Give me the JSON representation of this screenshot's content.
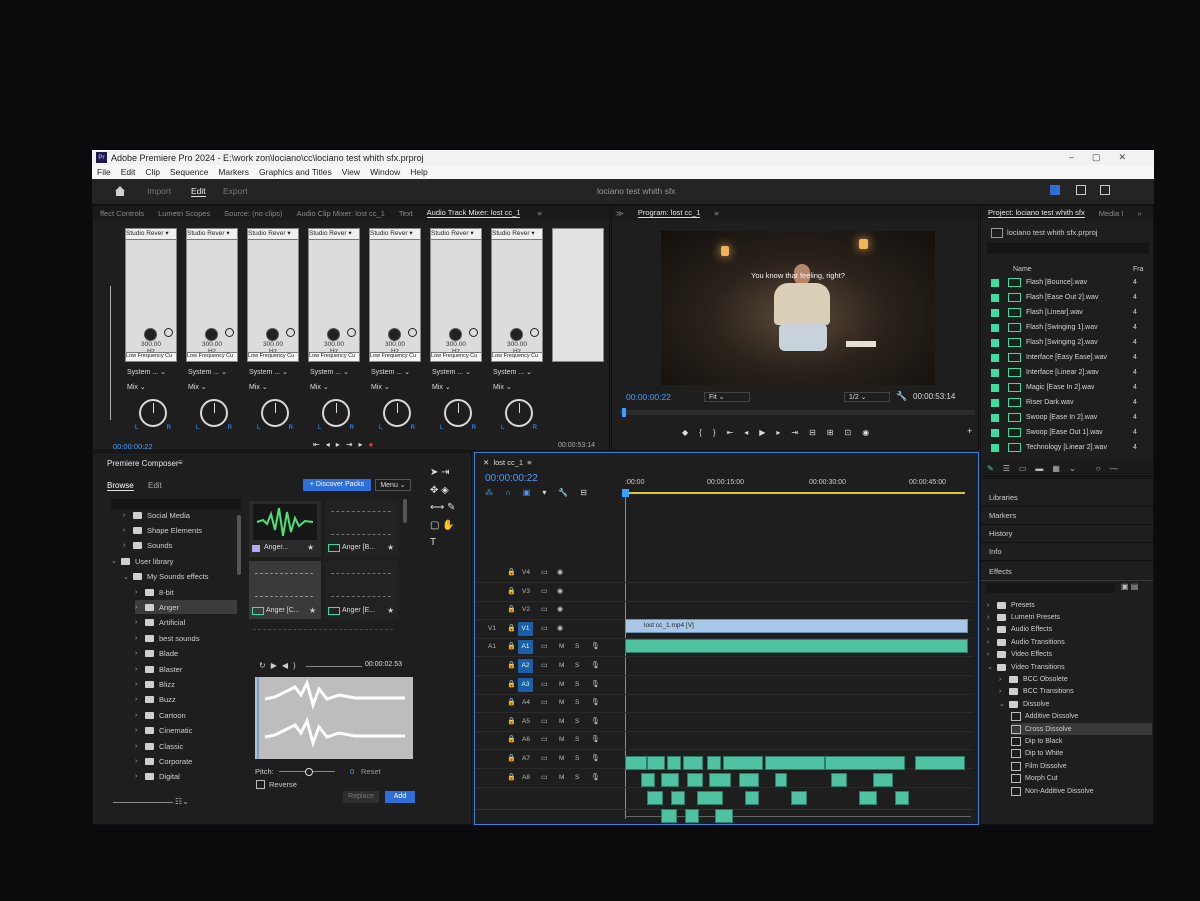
{
  "window": {
    "title": "Adobe Premiere Pro 2024 - E:\\work zon\\lociano\\cc\\lociano test whith sfx.prproj",
    "menu": [
      "File",
      "Edit",
      "Clip",
      "Sequence",
      "Markers",
      "Graphics and Titles",
      "View",
      "Window",
      "Help"
    ]
  },
  "header": {
    "workspaces": [
      "Import",
      "Edit",
      "Export"
    ],
    "active_workspace": "Edit",
    "project_name": "lociano test whith sfx"
  },
  "mixer": {
    "tabs": [
      "ffect Controls",
      "Lumetri Scopes",
      "Source: (no clips)",
      "Audio Clip Mixer: lost cc_1",
      "Text",
      "Audio Track Mixer: lost cc_1"
    ],
    "effect_label": "Studio Rever",
    "hz_value": "300.00",
    "hz_unit": "Hz",
    "low_freq_label": "Low Frequency Cu",
    "system_label": "System ...",
    "mix_label": "Mix",
    "timecode_left": "00:00:00:22",
    "timecode_right": "00:00:53:14"
  },
  "program": {
    "title": "Program: lost cc_1",
    "subtitle": "You know that feeling, right?",
    "timecode": "00:00:00:22",
    "fit": "Fit",
    "resolution": "1/2",
    "duration": "00:00:53:14"
  },
  "project": {
    "title": "Project: lociano test whith sfx",
    "tab2": "Media I",
    "file": "lociano test whith sfx.prproj",
    "col_name": "Name",
    "col_frame": "Fra",
    "items": [
      {
        "name": "Flash [Bounce].wav",
        "rate": "4"
      },
      {
        "name": "Flash [Ease Out 2].wav",
        "rate": "4"
      },
      {
        "name": "Flash [Linear].wav",
        "rate": "4"
      },
      {
        "name": "Flash [Swinging 1].wav",
        "rate": "4"
      },
      {
        "name": "Flash [Swinging 2].wav",
        "rate": "4"
      },
      {
        "name": "Interface [Easy Ease].wav",
        "rate": "4"
      },
      {
        "name": "Interface [Linear 2].wav",
        "rate": "4"
      },
      {
        "name": "Magic [Ease In 2].wav",
        "rate": "4"
      },
      {
        "name": "Riser Dark.wav",
        "rate": "4"
      },
      {
        "name": "Swoop [Ease In 2].wav",
        "rate": "4"
      },
      {
        "name": "Swoop [Ease Out 1].wav",
        "rate": "4"
      },
      {
        "name": "Technology [Linear 2].wav",
        "rate": "4"
      }
    ]
  },
  "side_panels": [
    "Libraries",
    "Markers",
    "History",
    "Info",
    "Effects"
  ],
  "effects": [
    {
      "label": "Presets",
      "indent": 0,
      "expanded": false
    },
    {
      "label": "Lumetri Presets",
      "indent": 0,
      "expanded": false
    },
    {
      "label": "Audio Effects",
      "indent": 0,
      "expanded": false
    },
    {
      "label": "Audio Transitions",
      "indent": 0,
      "expanded": false
    },
    {
      "label": "Video Effects",
      "indent": 0,
      "expanded": false
    },
    {
      "label": "Video Transitions",
      "indent": 0,
      "expanded": true
    },
    {
      "label": "BCC Obsolete",
      "indent": 1,
      "expanded": false
    },
    {
      "label": "BCC Transitions",
      "indent": 1,
      "expanded": false
    },
    {
      "label": "Dissolve",
      "indent": 1,
      "expanded": true
    },
    {
      "label": "Additive Dissolve",
      "indent": 2,
      "item": true
    },
    {
      "label": "Cross Dissolve",
      "indent": 2,
      "item": true,
      "selected": true
    },
    {
      "label": "Dip to Black",
      "indent": 2,
      "item": true
    },
    {
      "label": "Dip to White",
      "indent": 2,
      "item": true
    },
    {
      "label": "Film Dissolve",
      "indent": 2,
      "item": true
    },
    {
      "label": "Morph Cut",
      "indent": 2,
      "item": true
    },
    {
      "label": "Non-Additive Dissolve",
      "indent": 2,
      "item": true
    }
  ],
  "composer": {
    "title": "Premiere Composer",
    "tabs": [
      "Browse",
      "Edit"
    ],
    "discover": "+ Discover Packs",
    "menu": "Menu",
    "tree": [
      {
        "label": "Social Media",
        "level": 1
      },
      {
        "label": "Shape Elements",
        "level": 1
      },
      {
        "label": "Sounds",
        "level": 1
      },
      {
        "label": "User library",
        "level": 0,
        "expanded": true
      },
      {
        "label": "My Sounds effects",
        "level": 1,
        "expanded": true
      },
      {
        "label": "8-bit",
        "level": 2
      },
      {
        "label": "Anger",
        "level": 2,
        "selected": true
      },
      {
        "label": "Artificial",
        "level": 2
      },
      {
        "label": "best sounds",
        "level": 2
      },
      {
        "label": "Blade",
        "level": 2
      },
      {
        "label": "Blaster",
        "level": 2
      },
      {
        "label": "Blizz",
        "level": 2
      },
      {
        "label": "Buzz",
        "level": 2
      },
      {
        "label": "Cartoon",
        "level": 2
      },
      {
        "label": "Cinematic",
        "level": 2
      },
      {
        "label": "Classic",
        "level": 2
      },
      {
        "label": "Corporate",
        "level": 2
      },
      {
        "label": "Digital",
        "level": 2
      }
    ],
    "thumbs": [
      "Anger...",
      "Anger [B...",
      "Anger [C...",
      "Anger [E..."
    ],
    "preview_time": "00:00:02.53",
    "pitch_label": "Pitch:",
    "pitch_value": "0",
    "reset": "Reset",
    "reverse": "Reverse",
    "replace": "Replace",
    "add": "Add"
  },
  "timeline": {
    "tab": "lost cc_1",
    "timecode": "00:00:00:22",
    "ruler": [
      ":00:00",
      "00:00:15:00",
      "00:00:30:00",
      "00:00:45:00"
    ],
    "video_tracks": [
      "V4",
      "V3",
      "V2",
      "V1"
    ],
    "audio_tracks": [
      "A1",
      "A2",
      "A3",
      "A4",
      "A5",
      "A6",
      "A7",
      "A8"
    ],
    "source_v": "V1",
    "source_a": "A1",
    "clip_label": "lost cc_1.mp4 [V]",
    "mute": "M",
    "solo": "S"
  },
  "colors": {
    "accent": "#2d8ceb",
    "clip_audio": "#4fc3a1",
    "clip_video": "#a8c7e6",
    "playhead": "#3aa0ff"
  }
}
